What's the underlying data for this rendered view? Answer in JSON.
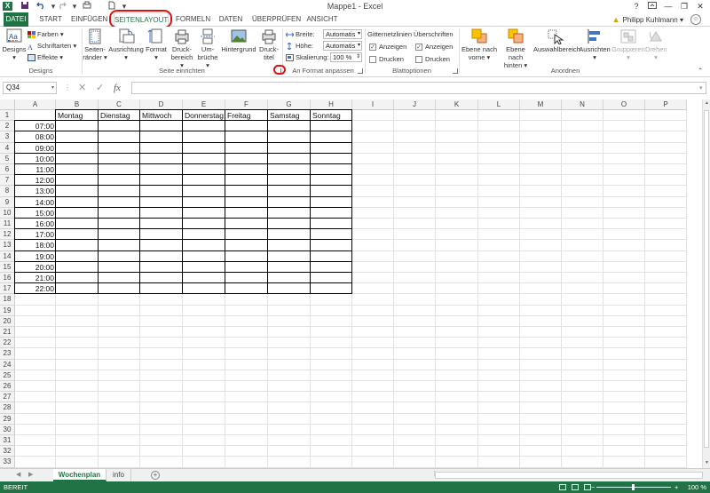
{
  "window": {
    "title": "Mappe1 - Excel",
    "logo_letter": "X",
    "help": "?",
    "minimize": "—",
    "restore": "❐",
    "close": "✕"
  },
  "quick_access": [
    "save-icon",
    "undo-icon",
    "redo-icon",
    "new-icon",
    "customize-icon"
  ],
  "tabs": [
    {
      "label": "DATEI"
    },
    {
      "label": "START"
    },
    {
      "label": "EINFÜGEN"
    },
    {
      "label": "SEITENLAYOUT"
    },
    {
      "label": "FORMELN"
    },
    {
      "label": "DATEN"
    },
    {
      "label": "ÜBERPRÜFEN"
    },
    {
      "label": "ANSICHT"
    }
  ],
  "user": {
    "name": "Philipp Kuhlmann",
    "warning_glyph": "▲",
    "dropdown": "▾"
  },
  "ribbon": {
    "designs": {
      "label": "Designs",
      "designs_btn": "Designs",
      "colors": "Farben",
      "fonts": "Schriftarten",
      "effects": "Effekte"
    },
    "page_setup": {
      "label": "Seite einrichten",
      "margins": [
        "Seiten-",
        "ränder"
      ],
      "orientation": "Ausrichtung",
      "size": "Format",
      "print_area": [
        "Druck-",
        "bereich"
      ],
      "breaks": [
        "Um-",
        "brüche"
      ],
      "background": "Hintergrund",
      "print_titles": [
        "Druck-",
        "titel"
      ]
    },
    "scale": {
      "label": "An Format anpassen",
      "width_label": "Breite:",
      "width_value": "Automatis",
      "height_label": "Höhe:",
      "height_value": "Automatis",
      "scale_label": "Skalierung:",
      "scale_value": "100 %"
    },
    "sheet_options": {
      "label": "Blattoptionen",
      "gridlines": "Gitternetzlinien",
      "headings": "Überschriften",
      "view": "Anzeigen",
      "print": "Drucken"
    },
    "arrange": {
      "label": "Anordnen",
      "bring_forward": [
        "Ebene nach",
        "vorne"
      ],
      "send_backward": [
        "Ebene nach",
        "hinten"
      ],
      "selection_pane": "Auswahlbereich",
      "align": "Ausrichten",
      "group": "Gruppieren",
      "rotate": "Drehen"
    }
  },
  "formula_bar": {
    "name_box": "Q34",
    "cancel": "✕",
    "enter": "✓",
    "fx": "fx",
    "value": ""
  },
  "grid": {
    "columns": [
      "A",
      "B",
      "C",
      "D",
      "E",
      "F",
      "G",
      "H",
      "I",
      "J",
      "K",
      "L",
      "M",
      "N",
      "O",
      "P"
    ],
    "header_row": [
      "Montag",
      "Dienstag",
      "Mittwoch",
      "Donnerstag",
      "Freitag",
      "Samstag",
      "Sonntag"
    ],
    "times": [
      "07:00",
      "08:00",
      "09:00",
      "10:00",
      "11:00",
      "12:00",
      "13:00",
      "14:00",
      "15:00",
      "16:00",
      "17:00",
      "18:00",
      "19:00",
      "20:00",
      "21:00",
      "22:00"
    ],
    "row_count": 34,
    "selected_row": 34
  },
  "sheets": [
    {
      "name": "Wochenplan",
      "active": true
    },
    {
      "name": "info",
      "active": false
    }
  ],
  "add_sheet": "+",
  "status": {
    "ready": "BEREIT",
    "zoom": "100 %",
    "zoom_minus": "−",
    "zoom_plus": "+"
  },
  "colors": {
    "excel_green": "#217346",
    "highlight_red": "#d11111"
  }
}
